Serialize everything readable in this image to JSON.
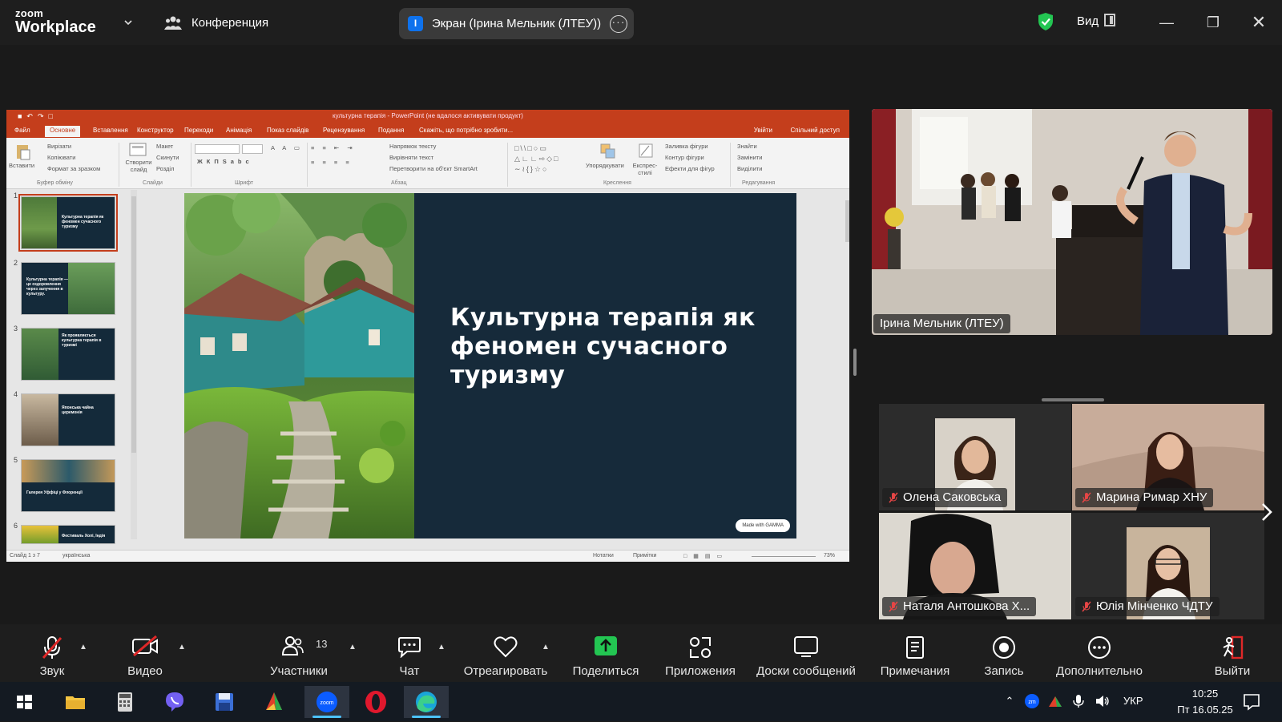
{
  "topbar": {
    "brand_line1": "zoom",
    "brand_line2": "Workplace",
    "meeting_label": "Конференция",
    "share_badge": "I",
    "share_label": "Экран (Ірина Мельник  (ЛТЕУ))",
    "view_label": "Вид",
    "shield_color": "#23c552"
  },
  "powerpoint": {
    "title_bar": "культурна терапія - PowerPoint (не вдалося активувати продукт)",
    "ribbon_tabs": [
      "Файл",
      "Основне",
      "Вставлення",
      "Конструктор",
      "Переходи",
      "Анімація",
      "Показ слайдів",
      "Рецензування",
      "Подання",
      "Скажіть, що потрібно зробити..."
    ],
    "active_tab": "Основне",
    "login": "Увійти",
    "share": "Спільний доступ",
    "ribbon_items": {
      "paste": "Вставити",
      "cut": "Вирізати",
      "copy": "Копіювати",
      "format_painter": "Формат за зразком",
      "new_slide": "Створити слайд",
      "layout": "Макет",
      "reset": "Скинути",
      "section": "Розділ",
      "text_direction": "Напрямок тексту",
      "align_text": "Вирівняти текст",
      "smartart": "Перетворити на об'єкт SmartArt",
      "arrange": "Упорядкувати",
      "quick_styles": "Експрес-стилі",
      "shape_fill": "Заливка фігури",
      "shape_outline": "Контур фігури",
      "shape_effects": "Ефекти для фігур",
      "find": "Знайти",
      "replace": "Замінити",
      "select": "Виділити"
    },
    "ribbon_groups": [
      "Буфер обміну",
      "Слайди",
      "Шрифт",
      "Абзац",
      "Креслення",
      "Редагування"
    ],
    "thumbnails": [
      {
        "num": "1",
        "title": "Культурна терапія як феномен сучасного туризму"
      },
      {
        "num": "2",
        "title": "Культурна терапія — це оздоровлення через залучення в культуру."
      },
      {
        "num": "3",
        "title": "Як проявляється культурна терапія в туризмі"
      },
      {
        "num": "4",
        "title": "Японська чайна церемонія"
      },
      {
        "num": "5",
        "title": "Галерея Уффіці у Флоренції"
      },
      {
        "num": "6",
        "title": "Фестиваль Холі, Індія"
      }
    ],
    "slide": {
      "title": "Культурна терапія як феномен сучасного туризму",
      "badge": "Made with GAMMA",
      "bg_color": "#162a3a"
    },
    "status": {
      "slide_count": "Слайд 1 з 7",
      "language": "українська",
      "notes": "Нотатки",
      "comments": "Примітки",
      "zoom": "73%"
    }
  },
  "speaker": {
    "name": "Ірина Мельник  (ЛТЕУ)"
  },
  "gallery": [
    {
      "name": "Олена Саковська",
      "muted": true
    },
    {
      "name": "Марина Римар ХНУ",
      "muted": true
    },
    {
      "name": "Наталя Антошкова Х...",
      "muted": true
    },
    {
      "name": "Юлія Мінченко ЧДТУ",
      "muted": true
    }
  ],
  "controls": {
    "audio": "Звук",
    "video": "Видео",
    "participants": "Участники",
    "participants_count": "13",
    "chat": "Чат",
    "react": "Отреагировать",
    "share": "Поделиться",
    "apps": "Приложения",
    "whiteboards": "Доски сообщений",
    "notes": "Примечания",
    "record": "Запись",
    "more": "Дополнительно",
    "leave": "Выйти",
    "share_color": "#23c552",
    "leave_color": "#e02828"
  },
  "taskbar": {
    "language": "УКР",
    "time": "10:25",
    "date": "Пт 16.05.25"
  }
}
